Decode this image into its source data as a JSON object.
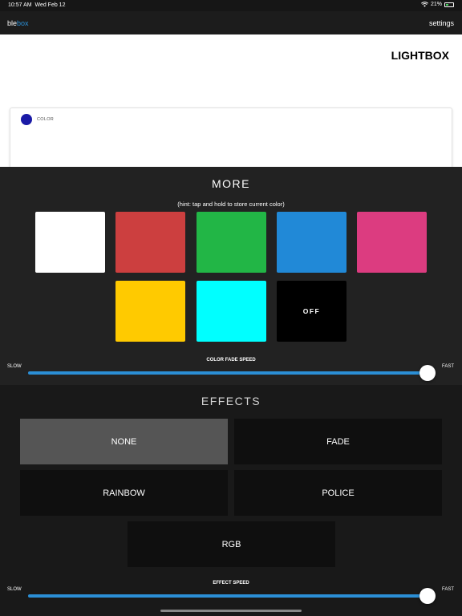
{
  "status_bar": {
    "time": "10:57 AM",
    "date": "Wed Feb 12",
    "battery": "21%",
    "wifi_icon": "wifi-icon",
    "battery_icon": "battery-icon"
  },
  "navbar": {
    "brand_prefix": "ble",
    "brand_suffix": "box",
    "settings_label": "settings"
  },
  "device": {
    "title": "LIGHTBOX"
  },
  "color_card": {
    "label": "COLOR",
    "current_color": "#1a1aa6"
  },
  "more": {
    "title": "MORE",
    "hint": "(hint: tap and hold to store current color)",
    "swatches": [
      {
        "color": "#ffffff"
      },
      {
        "color": "#cc3f3f"
      },
      {
        "color": "#22b646"
      },
      {
        "color": "#2189d7"
      },
      {
        "color": "#dc3c80"
      },
      {
        "color": "#ffca00"
      },
      {
        "color": "#00ffff"
      },
      {
        "color": "#000000",
        "label": "OFF"
      }
    ],
    "fade_speed": {
      "caption": "COLOR FADE SPEED",
      "min_label": "SLOW",
      "max_label": "FAST",
      "value_fraction": 1.0
    }
  },
  "effects": {
    "title": "EFFECTS",
    "options": [
      "NONE",
      "FADE",
      "RAINBOW",
      "POLICE",
      "RGB"
    ],
    "selected": "NONE",
    "effect_speed": {
      "caption": "EFFECT SPEED",
      "min_label": "SLOW",
      "max_label": "FAST",
      "value_fraction": 1.0
    }
  },
  "colors": {
    "accent": "#2b8fd6",
    "panel": "#222222",
    "effects_panel": "#191919",
    "effect_active": "#555555"
  }
}
